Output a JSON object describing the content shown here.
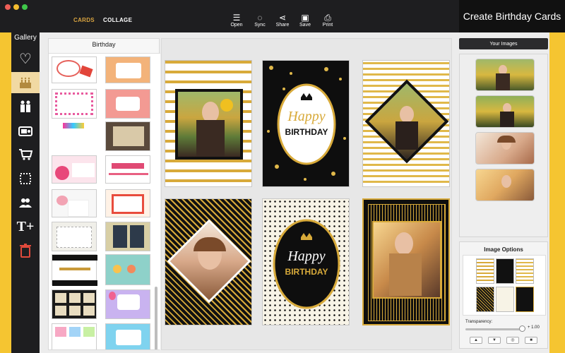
{
  "window": {
    "nav": {
      "cards": "CARDS",
      "collage": "COLLAGE"
    },
    "toolbar": [
      {
        "label": "Open",
        "icon": "open-icon",
        "glyph": "☰"
      },
      {
        "label": "Sync",
        "icon": "sync-icon",
        "glyph": "◌"
      },
      {
        "label": "Share",
        "icon": "share-icon",
        "glyph": "⋖"
      },
      {
        "label": "Save",
        "icon": "save-icon",
        "glyph": "▣"
      },
      {
        "label": "Print",
        "icon": "print-icon",
        "glyph": "⎙"
      }
    ],
    "promo": "Create Birthday Cards"
  },
  "sidebar": {
    "title": "Gallery",
    "items": [
      {
        "name": "love",
        "icon": "heart-icon",
        "glyph": "♡"
      },
      {
        "name": "birthday",
        "icon": "cake-icon",
        "glyph": "♨",
        "active": true
      },
      {
        "name": "family",
        "icon": "family-icon",
        "glyph": "👪"
      },
      {
        "name": "radio",
        "icon": "radio-icon",
        "glyph": "📻"
      },
      {
        "name": "cart",
        "icon": "cart-icon",
        "glyph": "🛒"
      },
      {
        "name": "frame",
        "icon": "frame-icon",
        "glyph": "⬚"
      },
      {
        "name": "friends",
        "icon": "friends-icon",
        "glyph": "👥"
      },
      {
        "name": "text",
        "icon": "text-plus-icon",
        "glyph": "T+"
      },
      {
        "name": "delete",
        "icon": "trash-icon",
        "glyph": "🗑"
      }
    ]
  },
  "left_panel": {
    "title": "Birthday"
  },
  "right_panel": {
    "your_images": "Your Images",
    "options_title": "Image Options",
    "transparency_label": "Transparency:",
    "transparency_value": "+ 1.00",
    "transparency_level": 1.0,
    "buttons": [
      {
        "icon": "up-arrow-icon",
        "glyph": "▲"
      },
      {
        "icon": "down-arrow-icon",
        "glyph": "▼"
      },
      {
        "icon": "settings-icon",
        "glyph": "◎"
      },
      {
        "icon": "trash-icon",
        "glyph": "■"
      }
    ]
  },
  "cards": {
    "card2": {
      "line1": "Happy",
      "line2": "BIRTHDAY"
    },
    "card5": {
      "line1": "Happy",
      "line2": "BIRTHDAY"
    }
  },
  "colors": {
    "accent": "#f5c531",
    "dark": "#1e1e20",
    "gold": "#d4a92c",
    "trash": "#e04a3c",
    "nav_active": "#d9a440"
  }
}
